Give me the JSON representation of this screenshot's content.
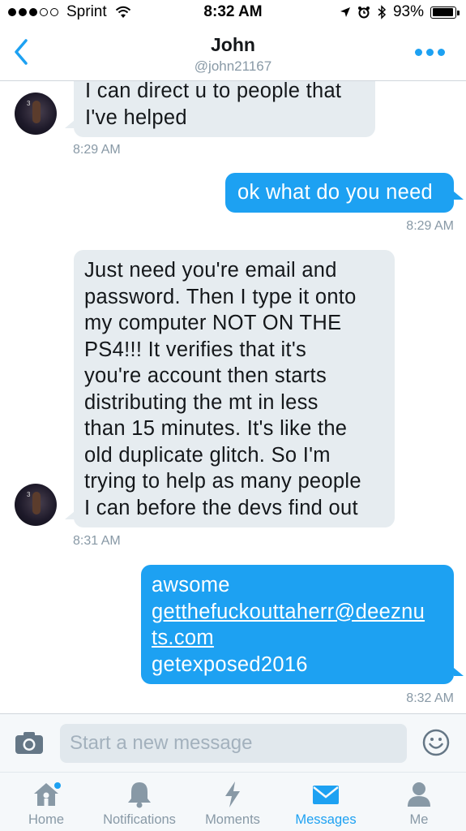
{
  "status_bar": {
    "carrier": "Sprint",
    "time": "8:32 AM",
    "battery": "93%",
    "battery_level": 0.93
  },
  "header": {
    "title": "John",
    "handle": "@john21167"
  },
  "messages": [
    {
      "direction": "received",
      "lines": [
        "I can direct u to people that",
        "I've helped"
      ],
      "time": "8:29 AM"
    },
    {
      "direction": "sent",
      "lines": [
        "ok what do you need"
      ],
      "time": "8:29 AM"
    },
    {
      "direction": "received",
      "lines": [
        "Just need you're email and",
        "password. Then I type it onto",
        "my computer NOT ON THE",
        "PS4!!! It verifies that it's",
        "you're account then starts",
        "distributing the mt in less",
        "than 15 minutes. It's like the",
        "old duplicate glitch. So I'm",
        "trying to help as many people",
        "I can before the devs find out"
      ],
      "time": "8:31 AM"
    },
    {
      "direction": "sent",
      "lines": [
        "awsome",
        "getthefuckouttaherr@deeznu",
        "ts.com",
        "getexposed2016"
      ],
      "time": "8:32 AM"
    }
  ],
  "composer": {
    "placeholder": "Start a new message"
  },
  "tabs": [
    {
      "label": "Home",
      "icon": "home-icon",
      "active": false
    },
    {
      "label": "Notifications",
      "icon": "bell-icon",
      "active": false
    },
    {
      "label": "Moments",
      "icon": "lightning-icon",
      "active": false
    },
    {
      "label": "Messages",
      "icon": "envelope-icon",
      "active": true
    },
    {
      "label": "Me",
      "icon": "person-icon",
      "active": false
    }
  ],
  "colors": {
    "accent": "#1da1f2",
    "received_bubble": "#e6ecf0",
    "muted_text": "#8899a6"
  }
}
